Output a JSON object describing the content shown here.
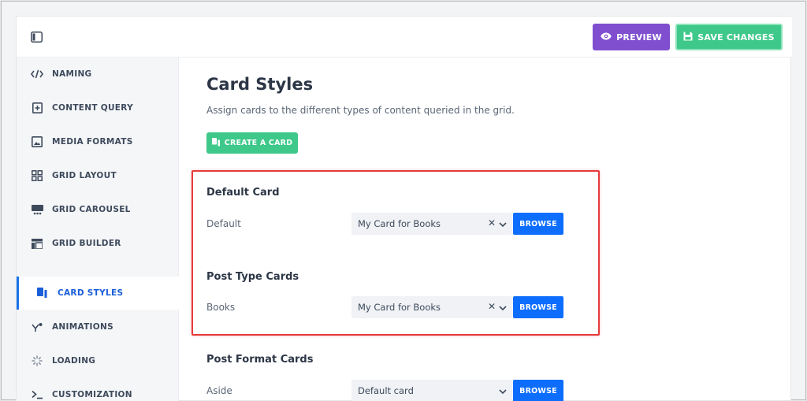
{
  "topbar": {
    "sidebar_toggle_icon": "sidebar-toggle-icon",
    "preview_label": "PREVIEW",
    "save_label": "SAVE CHANGES"
  },
  "sidebar": {
    "items": [
      {
        "label": "NAMING",
        "icon": "code-icon"
      },
      {
        "label": "CONTENT QUERY",
        "icon": "file-add-icon"
      },
      {
        "label": "MEDIA FORMATS",
        "icon": "image-icon"
      },
      {
        "label": "GRID LAYOUT",
        "icon": "grid-icon"
      },
      {
        "label": "GRID CAROUSEL",
        "icon": "carousel-icon"
      },
      {
        "label": "GRID BUILDER",
        "icon": "layout-icon"
      },
      {
        "label": "CARD STYLES",
        "icon": "cards-icon",
        "active": true
      },
      {
        "label": "ANIMATIONS",
        "icon": "animation-icon"
      },
      {
        "label": "LOADING",
        "icon": "loading-icon"
      },
      {
        "label": "CUSTOMIZATION",
        "icon": "terminal-icon"
      }
    ]
  },
  "main": {
    "title": "Card Styles",
    "description": "Assign cards to the different types of content queried in the grid.",
    "create_label": "CREATE A CARD",
    "sections": [
      {
        "title": "Default Card",
        "rows": [
          {
            "label": "Default",
            "value": "My Card for Books",
            "clearable": true,
            "browse_label": "BROWSE"
          }
        ]
      },
      {
        "title": "Post Type Cards",
        "rows": [
          {
            "label": "Books",
            "value": "My Card for Books",
            "clearable": true,
            "browse_label": "BROWSE"
          }
        ]
      },
      {
        "title": "Post Format Cards",
        "rows": [
          {
            "label": "Aside",
            "value": "Default card",
            "clearable": false,
            "browse_label": "BROWSE"
          }
        ]
      }
    ]
  },
  "colors": {
    "preview": "#7f4fcf",
    "save": "#3ec88a",
    "browse": "#0d6efd",
    "active_nav": "#1a73e8",
    "highlight": "#e53b3b"
  }
}
